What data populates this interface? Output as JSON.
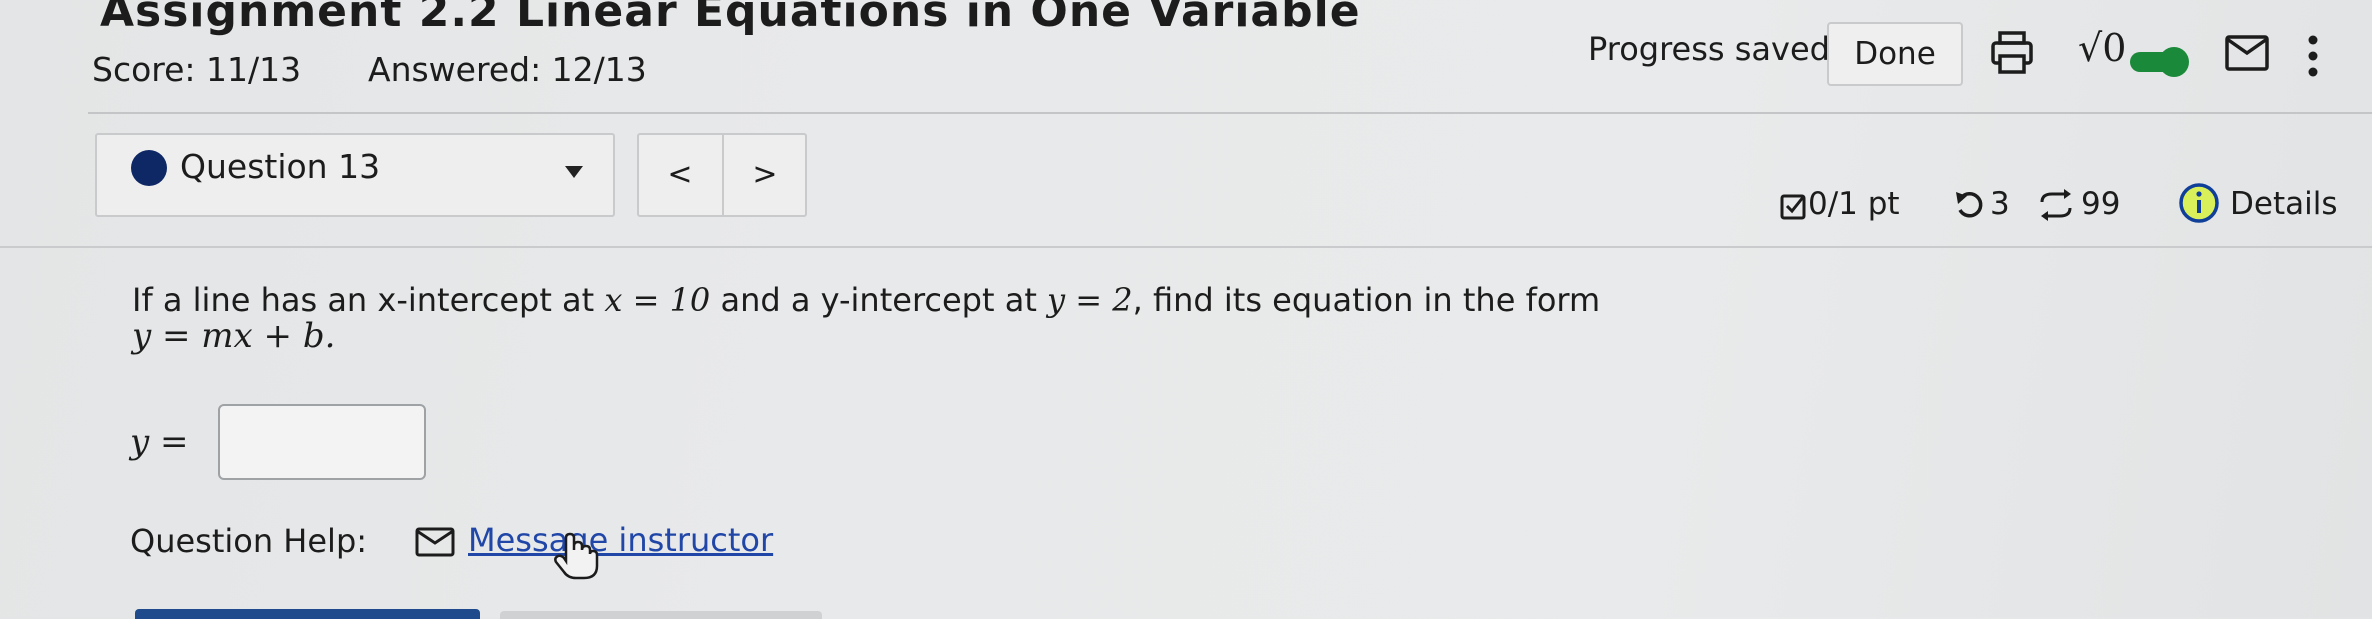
{
  "header": {
    "title": "Assignment 2.2 Linear Equations in One Variable",
    "score": "Score: 11/13",
    "answered": "Answered: 12/13",
    "progress_status": "Progress saved",
    "done_label": "Done",
    "sqrt_label": "√0"
  },
  "question_nav": {
    "selected": "Question 13",
    "prev": "<",
    "next": ">"
  },
  "meta": {
    "points": "0/1 pt",
    "retries": "3",
    "attempts": "99",
    "details": "Details"
  },
  "question": {
    "text_part1": "If a line has an x-intercept at ",
    "x_eq": "x = 10",
    "text_part2": " and a y-intercept at ",
    "y_eq": "y = 2",
    "text_part3": ", find its equation in the form",
    "form": "y = mx + b.",
    "answer_label": "y =",
    "answer_value": ""
  },
  "help": {
    "label": "Question Help:",
    "link": "Message instructor"
  },
  "colors": {
    "question_dot": "#0e2866",
    "toggle_on": "#1a8a3a",
    "link": "#2046a8",
    "info": "#0f3f99"
  }
}
